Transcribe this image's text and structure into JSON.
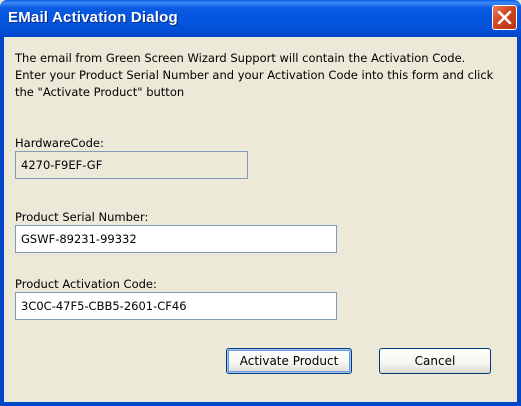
{
  "window": {
    "title": "EMail Activation Dialog"
  },
  "instructions": [
    "The email from Green Screen Wizard Support will contain the Activation Code.",
    "Enter your Product Serial Number and your Activation Code  into this form and click",
    "the \"Activate Product\" button"
  ],
  "hardware": {
    "label": "HardwareCode:",
    "value": "4270-F9EF-GF"
  },
  "serial": {
    "label": "Product Serial Number:",
    "value": "GSWF-89231-99332"
  },
  "activation": {
    "label": "Product Activation Code:",
    "value": "3C0C-47F5-CBB5-2601-CF46"
  },
  "buttons": {
    "activate": "Activate Product",
    "cancel": "Cancel"
  },
  "icons": {
    "close": "close-icon"
  },
  "colors": {
    "titlebar": "#0055E5",
    "close": "#D2451E",
    "face": "#ECE9D8"
  }
}
